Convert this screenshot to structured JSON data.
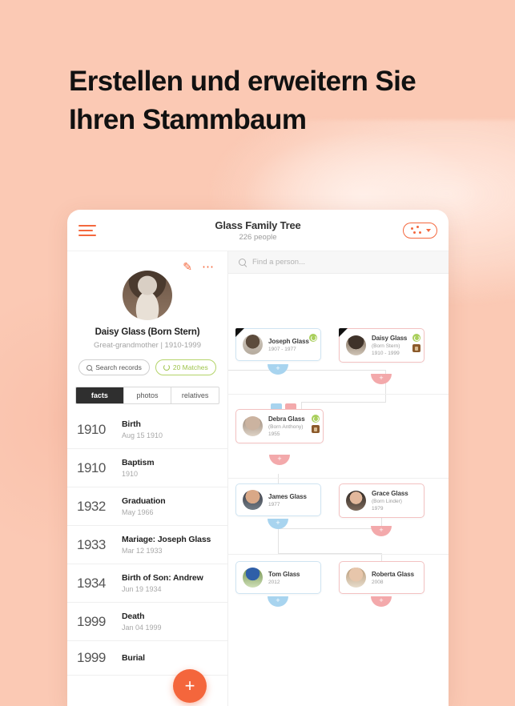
{
  "headline": "Erstellen und erweitern Sie Ihren Stammbaum",
  "colors": {
    "background": "#fbc9b4",
    "accent": "#f4683c",
    "green": "#a9cf5c",
    "blue": "#a8d4ef",
    "pink": "#f3a9ab"
  },
  "app": {
    "menu_icon": "hamburger-icon",
    "title": "Glass Family Tree",
    "subtitle": "226 people",
    "view_toggle_icon": "tree-view-icon"
  },
  "profile": {
    "edit_icon": "pencil-icon",
    "more_icon": "kebab-menu-icon",
    "avatar_icon": "profile-photo",
    "name": "Daisy Glass (Born Stern)",
    "meta": "Great-grandmother | 1910-1999",
    "search_records_label": "Search records",
    "matches_label": "20 Matches",
    "search_icon": "search-icon",
    "sync_icon": "sync-icon"
  },
  "tabs": [
    {
      "label": "facts",
      "active": true
    },
    {
      "label": "photos",
      "active": false
    },
    {
      "label": "relatives",
      "active": false
    }
  ],
  "timeline": [
    {
      "year": "1910",
      "label": "Birth",
      "date": "Aug 15 1910"
    },
    {
      "year": "1910",
      "label": "Baptism",
      "date": "1910"
    },
    {
      "year": "1932",
      "label": "Graduation",
      "date": "May 1966"
    },
    {
      "year": "1933",
      "label": "Mariage: Joseph Glass",
      "date": "Mar 12 1933"
    },
    {
      "year": "1934",
      "label": "Birth of Son: Andrew",
      "date": "Jun 19 1934"
    },
    {
      "year": "1999",
      "label": "Death",
      "date": "Jan 04 1999"
    },
    {
      "year": "1999",
      "label": "Burial",
      "date": ""
    }
  ],
  "add_fab": {
    "icon": "plus-icon",
    "label": "+"
  },
  "search": {
    "icon": "search-icon",
    "placeholder": "Find a person..."
  },
  "tree": {
    "nodes": [
      {
        "id": "joseph",
        "name": "Joseph Glass",
        "born": "",
        "years": "1907 - 1977",
        "color": "blue",
        "fold": true,
        "badges": [
          "green"
        ],
        "plus": "blue"
      },
      {
        "id": "daisy",
        "name": "Daisy Glass",
        "born": "(Born Stern)",
        "years": "1910 - 1999",
        "color": "pink",
        "fold": true,
        "badges": [
          "green",
          "brown"
        ],
        "plus": "pink"
      },
      {
        "id": "debra",
        "name": "Debra Glass",
        "born": "(Born Anthony)",
        "years": "1955",
        "color": "pink",
        "fold": false,
        "badges": [
          "green",
          "brown"
        ],
        "plus": "pink"
      },
      {
        "id": "james",
        "name": "James Glass",
        "born": "",
        "years": "1977",
        "color": "blue",
        "fold": false,
        "badges": [],
        "plus": "blue"
      },
      {
        "id": "grace",
        "name": "Grace Glass",
        "born": "(Born Linder)",
        "years": "1979",
        "color": "pink",
        "fold": false,
        "badges": [],
        "plus": "pink"
      },
      {
        "id": "tom",
        "name": "Tom Glass",
        "born": "",
        "years": "2012",
        "color": "blue",
        "fold": false,
        "badges": [],
        "plus": "blue"
      },
      {
        "id": "roberta",
        "name": "Roberta Glass",
        "born": "",
        "years": "2008",
        "color": "pink",
        "fold": false,
        "badges": [],
        "plus": "pink"
      }
    ],
    "plus_label": "+"
  }
}
